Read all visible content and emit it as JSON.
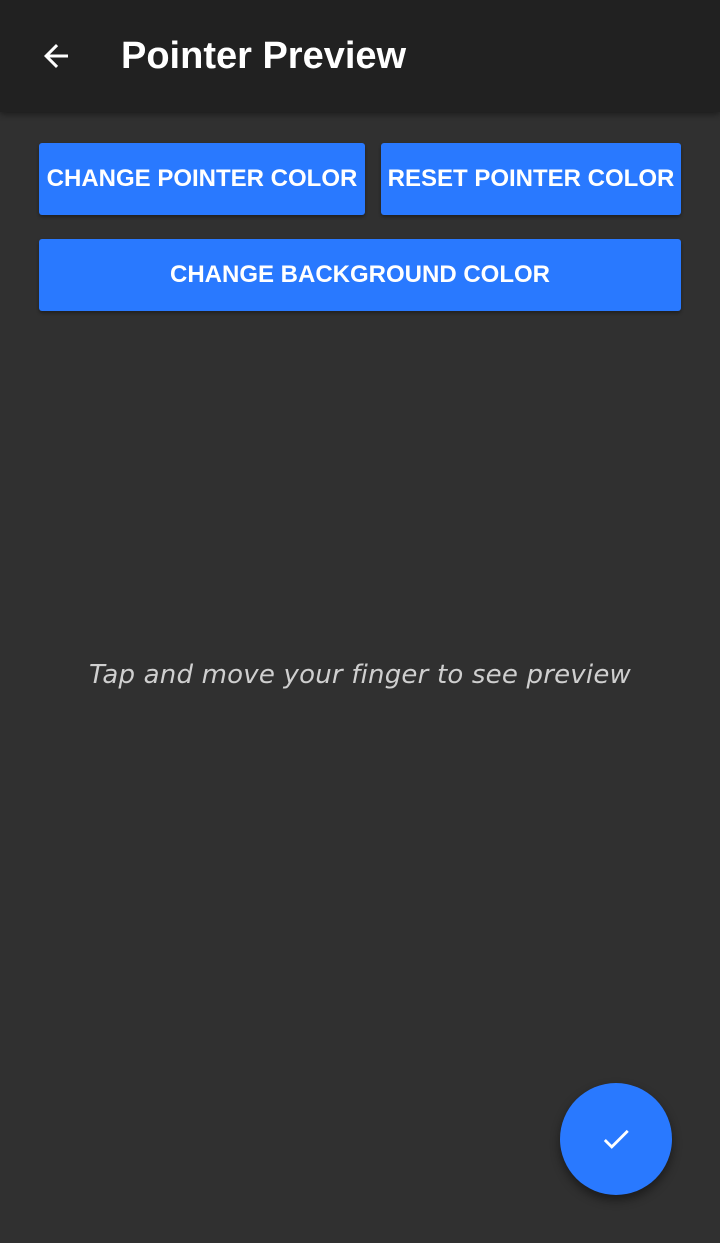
{
  "toolbar": {
    "title": "Pointer Preview",
    "back_icon": "arrow-back-icon",
    "background": "#212121"
  },
  "buttons": {
    "change_pointer_color": "CHANGE POINTER COLOR",
    "reset_pointer_color": "RESET POINTER COLOR",
    "change_background_color": "CHANGE BACKGROUND COLOR"
  },
  "preview": {
    "hint": "Tap and move your finger to see preview",
    "background": "#303030"
  },
  "fab": {
    "icon": "check-icon"
  },
  "colors": {
    "accent": "#2979ff",
    "text_primary": "#ffffff",
    "hint_text": "#cfcfcf"
  }
}
